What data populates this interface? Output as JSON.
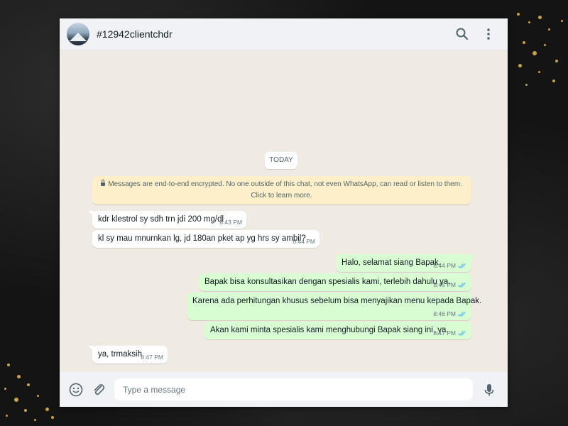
{
  "chat": {
    "title": "#12942clientchdr"
  },
  "day_label": "TODAY",
  "encryption_notice": "Messages are end-to-end encrypted. No one outside of this chat, not even WhatsApp, can read or listen to them. Click to learn more.",
  "messages": [
    {
      "direction": "incoming",
      "text": "kdr klestrol sy sdh trn jdi 200 mg/dl",
      "time": "8:43 PM"
    },
    {
      "direction": "incoming",
      "text": "kl sy mau mnurnkan lg, jd 180an pket ap yg hrs sy ambil?",
      "time": "8:44 PM"
    },
    {
      "direction": "outgoing",
      "text": "Halo, selamat siang Bapak.",
      "time": "8:44 PM",
      "status": "read"
    },
    {
      "direction": "outgoing",
      "text": "Bapak bisa konsultasikan dengan spesialis kami, terlebih dahulu ya.",
      "time": "8:45 PM",
      "status": "read"
    },
    {
      "direction": "outgoing",
      "text": "Karena ada perhitungan khusus sebelum bisa menyajikan menu kepada Bapak.",
      "time": "8:46 PM",
      "status": "read"
    },
    {
      "direction": "outgoing",
      "text": "Akan kami minta spesialis kami menghubungi Bapak siang ini, ya.",
      "time": "8:47 PM",
      "status": "read"
    },
    {
      "direction": "incoming",
      "text": "ya, trmaksih",
      "time": "8:47 PM"
    }
  ],
  "composer": {
    "placeholder": "Type a message"
  },
  "icons": {
    "header": [
      "search-icon",
      "menu-dots-icon"
    ],
    "footer": [
      "emoji-icon",
      "attach-icon",
      "mic-icon"
    ],
    "read_receipt": "double-check-icon"
  },
  "colors": {
    "incoming_bubble": "#ffffff",
    "outgoing_bubble": "#d9fdd3",
    "read_tick": "#53bdeb",
    "chat_background": "#efeae2",
    "notice_background": "#fcefc9",
    "accent_gold": "#c9a24a"
  }
}
